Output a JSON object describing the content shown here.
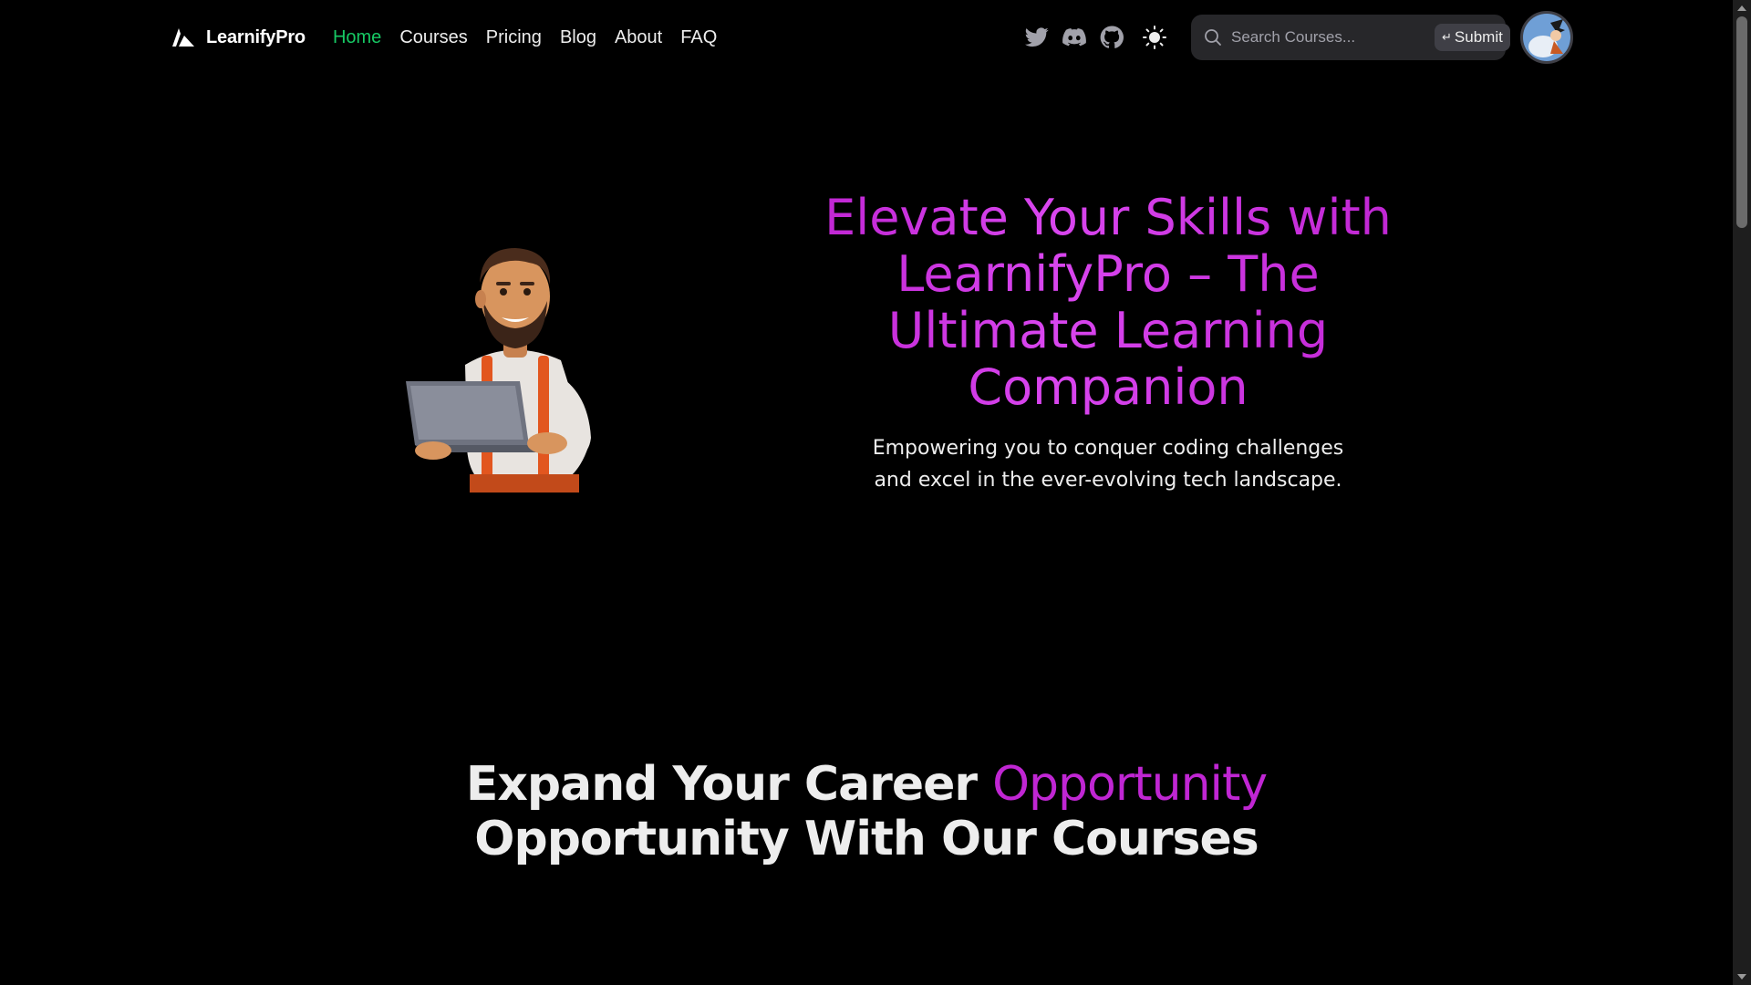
{
  "app": {
    "brand_name": "LearnifyPro",
    "accent_color": "#c026d3",
    "active_nav_color": "#17c964"
  },
  "navbar": {
    "links": [
      {
        "label": "Home",
        "active": true
      },
      {
        "label": "Courses",
        "active": false
      },
      {
        "label": "Pricing",
        "active": false
      },
      {
        "label": "Blog",
        "active": false
      },
      {
        "label": "About",
        "active": false
      },
      {
        "label": "FAQ",
        "active": false
      }
    ],
    "social_icons": [
      "twitter-icon",
      "discord-icon",
      "github-icon"
    ],
    "theme_toggle_icon": "sun-icon",
    "search": {
      "placeholder": "Search Courses...",
      "value": "",
      "submit_label": "Submit",
      "submit_icon": "enter-icon"
    },
    "avatar_icon": "user-avatar"
  },
  "hero": {
    "title": "Elevate Your Skills with LearnifyPro – The Ultimate Learning Companion",
    "subtitle": "Empowering you to conquer coding challenges and excel in the ever-evolving tech landscape.",
    "illustration": "developer-with-laptop-illustration"
  },
  "section": {
    "title_part1": "Expand Your Career ",
    "title_accent": "Opportunity",
    "title_part2": "Opportunity With Our Courses"
  }
}
